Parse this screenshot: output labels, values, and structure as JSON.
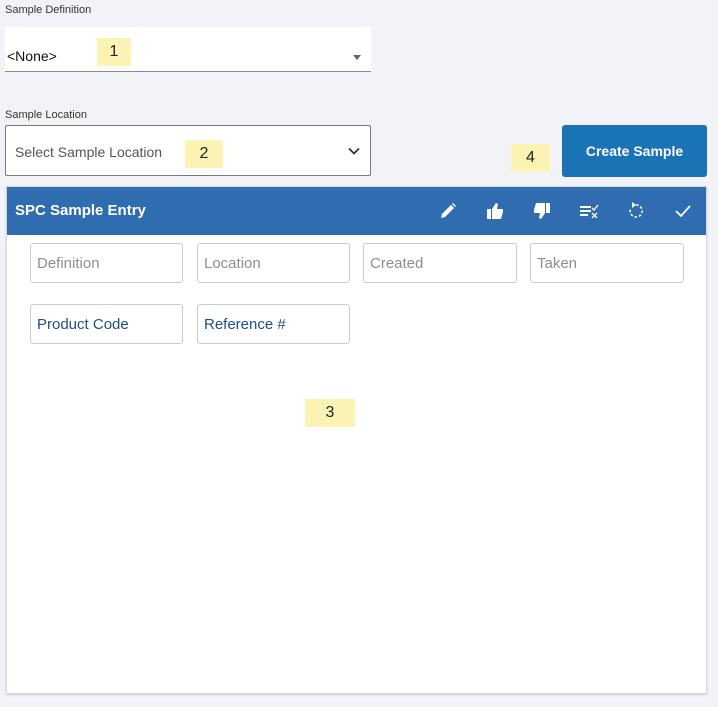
{
  "sample_definition": {
    "label": "Sample Definition",
    "value": "<None>"
  },
  "sample_location": {
    "label": "Sample Location",
    "placeholder": "Select Sample Location"
  },
  "create_button": {
    "label": "Create Sample"
  },
  "callouts": [
    "1",
    "2",
    "3",
    "4"
  ],
  "panel": {
    "title": "SPC Sample Entry",
    "toolbar": [
      {
        "icon": "pencil-icon"
      },
      {
        "icon": "thumbs-up-icon"
      },
      {
        "icon": "thumbs-down-icon"
      },
      {
        "icon": "list-check-icon"
      },
      {
        "icon": "undo-icon"
      },
      {
        "icon": "checkmark-icon"
      }
    ],
    "fields": {
      "definition": "Definition",
      "location": "Location",
      "created": "Created",
      "taken": "Taken",
      "product_code": "Product Code",
      "reference": "Reference #"
    }
  },
  "colors": {
    "header": "#2f6cb0",
    "button": "#1a73b5",
    "callout": "#fbf3b3",
    "background": "#f1f3f6"
  }
}
